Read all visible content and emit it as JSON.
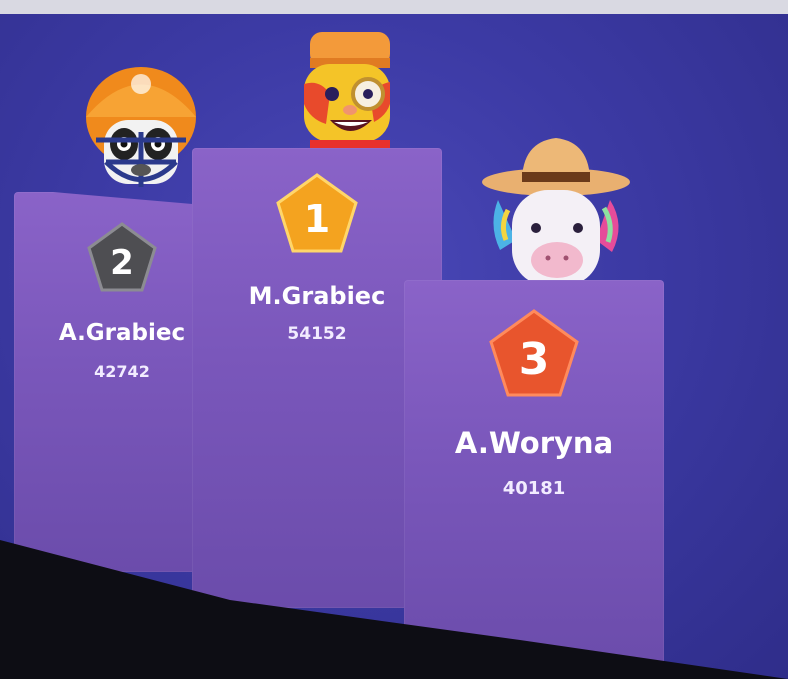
{
  "podium": [
    {
      "rank": "2",
      "name": "A.Grabiec",
      "score": "42742",
      "badge_color": "#5a5a5e",
      "avatar": "panda-football-helmet-icon"
    },
    {
      "rank": "1",
      "name": "M.Grabiec",
      "score": "54152",
      "badge_color": "#f0a020",
      "avatar": "monocle-character-icon"
    },
    {
      "rank": "3",
      "name": "A.Woryna",
      "score": "40181",
      "badge_color": "#e8552d",
      "avatar": "unicorn-cowboy-hat-icon"
    }
  ]
}
